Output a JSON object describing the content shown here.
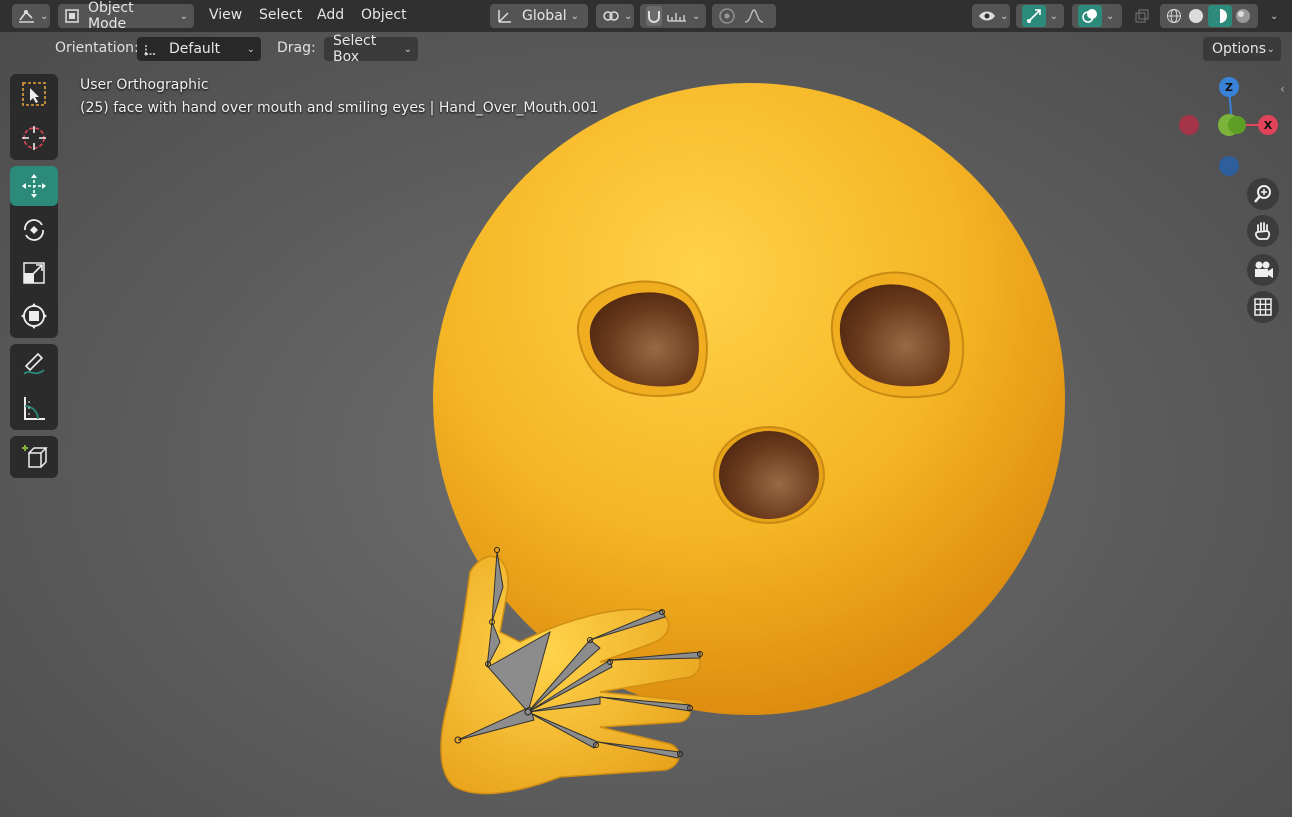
{
  "header": {
    "mode_label": "Object Mode",
    "menus": [
      "View",
      "Select",
      "Add",
      "Object"
    ],
    "transform_orientation": "Global"
  },
  "tool_settings": {
    "orientation_label": "Orientation:",
    "orientation_value": "Default",
    "drag_label": "Drag:",
    "drag_value": "Select Box",
    "options_label": "Options"
  },
  "viewport": {
    "view_name": "User Orthographic",
    "object_info": "(25) face with hand over mouth and smiling eyes | Hand_Over_Mouth.001"
  },
  "gizmo": {
    "z_label": "Z",
    "x_label": "X"
  },
  "toolbar_tools": [
    "select-box",
    "cursor",
    "move",
    "rotate",
    "scale",
    "transform",
    "annotate",
    "measure",
    "add-cube"
  ],
  "colors": {
    "accent": "#2b8a7a",
    "face": "#f2b120",
    "eye": "#6b3a1c",
    "axis_x": "#e0435a",
    "axis_y": "#7cb33a",
    "axis_z": "#3a82d8"
  }
}
